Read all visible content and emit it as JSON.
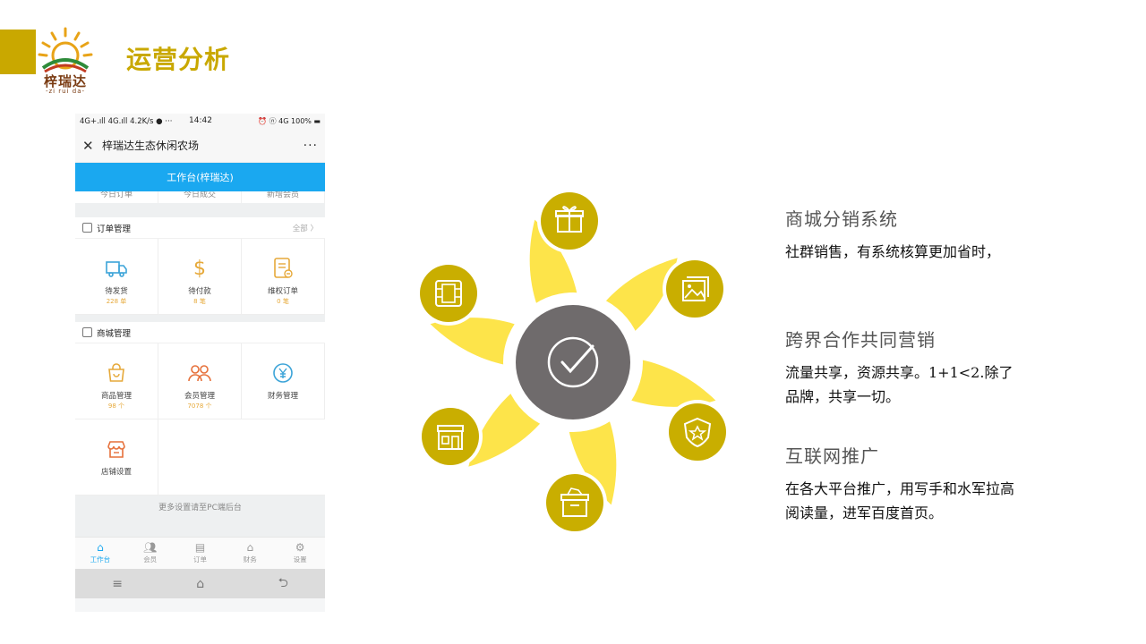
{
  "header": {
    "page_title": "运营分析",
    "logo": {
      "brand": "梓瑞达",
      "brand_sub": "-zi rui da-"
    },
    "accent_color": "#c9a800"
  },
  "phone": {
    "status_bar": {
      "left": "4G+.ıll 4G.ıll 4.2K/s ● ···",
      "time": "14:42",
      "right": "⏰ ⓝ 4G 100% ▬"
    },
    "nav": {
      "close_icon": "close-icon",
      "title": "梓瑞达生态休闲农场",
      "more_label": "···"
    },
    "workbench_label": "工作台(梓瑞达)",
    "stats": [
      "今日订单",
      "今日成交",
      "新增会员"
    ],
    "order_section": {
      "title": "订单管理",
      "more": "全部 〉",
      "items": [
        {
          "label": "待发货",
          "count": "228 单",
          "icon": "truck-icon"
        },
        {
          "label": "待付款",
          "count": "8 笔",
          "icon": "dollar-icon"
        },
        {
          "label": "维权订单",
          "count": "0 笔",
          "icon": "receipt-icon"
        }
      ]
    },
    "shop_section": {
      "title": "商城管理",
      "items": [
        {
          "label": "商品管理",
          "count": "98 个",
          "icon": "bag-icon"
        },
        {
          "label": "会员管理",
          "count": "7078 个",
          "icon": "users-icon"
        },
        {
          "label": "财务管理",
          "count": "",
          "icon": "yen-icon"
        },
        {
          "label": "店铺设置",
          "count": "",
          "icon": "store-icon"
        }
      ]
    },
    "more_settings": "更多设置请至PC端后台",
    "tabs": [
      {
        "label": "工作台",
        "icon": "home-icon",
        "active": true
      },
      {
        "label": "会员",
        "icon": "users-icon",
        "active": false
      },
      {
        "label": "订单",
        "icon": "order-icon",
        "active": false
      },
      {
        "label": "财务",
        "icon": "finance-icon",
        "active": false
      },
      {
        "label": "设置",
        "icon": "settings-icon",
        "active": false
      }
    ],
    "system_nav": {
      "menu": "≡",
      "home": "⌂",
      "back": "⮌"
    },
    "brand_blue": "#1aa8f0"
  },
  "diagram": {
    "center_icon": "check-circle-icon",
    "petal_color": "#fde44a",
    "circle_color": "#c9ae00",
    "center_color": "#6f6b6c",
    "icons": [
      "gift-icon",
      "image-icon",
      "shield-star-icon",
      "box-icon",
      "shop-icon",
      "film-icon"
    ]
  },
  "features": [
    {
      "title": "商城分销系统",
      "body": "社群销售，有系统核算更加省时，"
    },
    {
      "title": "跨界合作共同营销",
      "body": "流量共享，资源共享。1+1<2.除了品牌，共享一切。"
    },
    {
      "title": "互联网推广",
      "body": "在各大平台推广，用写手和水军拉高阅读量，进军百度首页。"
    }
  ]
}
